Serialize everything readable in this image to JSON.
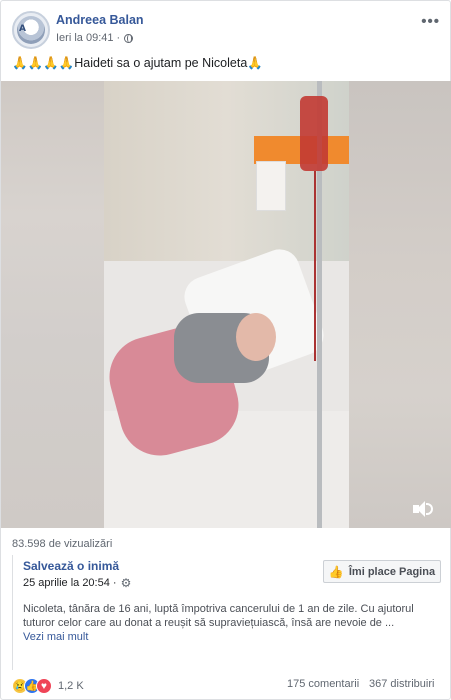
{
  "post": {
    "author": "Andreea Balan",
    "time": "Ieri la 09:41 ·",
    "text": "🙏🙏🙏🙏Haideti sa o ajutam pe Nicoleta🙏",
    "more_icon": "•••"
  },
  "video": {
    "views": "83.598 de vizualizări"
  },
  "shared_page": {
    "name": "Salvează o inimă",
    "date": "25 aprilie la 20:54 ·",
    "like_button": "Îmi place Pagina",
    "description": "Nicoleta, tânăra de 16 ani, luptă împotriva cancerului de 1 an de zile. Cu ajutorul tuturor celor care au donat a reușit să supraviețuiască, însă are nevoie de ...",
    "see_more": "Vezi mai mult"
  },
  "footer": {
    "reactions_count": "1,2 K",
    "comments": "175 comentarii",
    "shares": "367 distribuiri"
  },
  "colors": {
    "link_blue": "#365899",
    "muted": "#606770",
    "like_blue": "#2e75f0",
    "love_red": "#ef4457",
    "sad_yellow": "#f6c745"
  }
}
